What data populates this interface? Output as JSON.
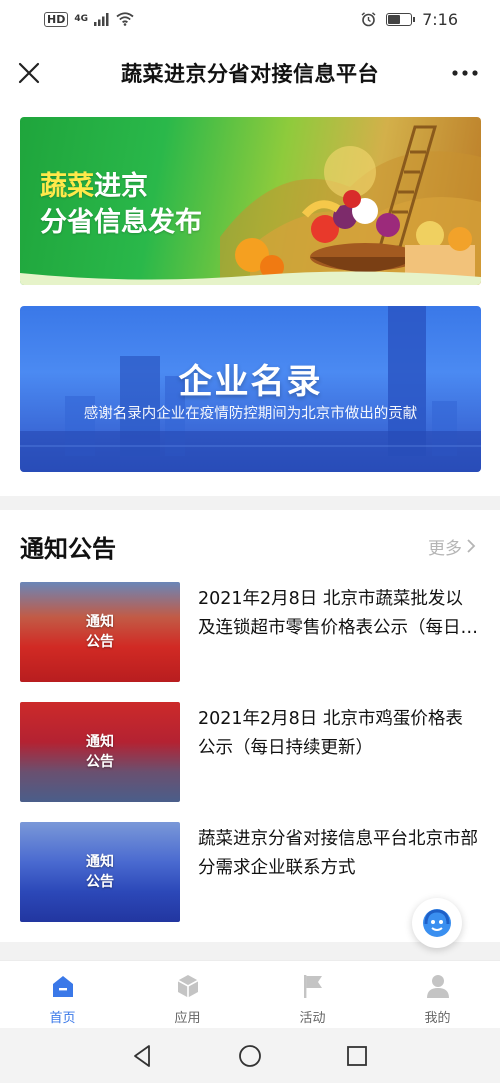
{
  "status_bar": {
    "hd": "HD",
    "network": "4G",
    "time": "7:16"
  },
  "nav": {
    "title": "蔬菜进京分省对接信息平台"
  },
  "banners": {
    "veg": {
      "line1_a": "蔬菜",
      "line1_b": "进京",
      "line2": "分省信息发布"
    },
    "enterprise": {
      "title": "企业名录",
      "subtitle": "感谢名录内企业在疫情防控期间为北京市做出的贡献"
    }
  },
  "notice": {
    "title": "通知公告",
    "more_label": "更多",
    "items": [
      {
        "thumb_text_1": "通知",
        "thumb_text_2": "公告",
        "text": "2021年2月8日 北京市蔬菜批发以及连锁超市零售价格表公示（每日…"
      },
      {
        "thumb_text_1": "通知",
        "thumb_text_2": "公告",
        "text": "2021年2月8日 北京市鸡蛋价格表公示（每日持续更新）"
      },
      {
        "thumb_text_1": "通知",
        "thumb_text_2": "公告",
        "text": "蔬菜进京分省对接信息平台北京市部分需求企业联系方式"
      }
    ]
  },
  "tabs": [
    {
      "label": "首页",
      "icon": "home-icon",
      "active": true
    },
    {
      "label": "应用",
      "icon": "cube-icon",
      "active": false
    },
    {
      "label": "活动",
      "icon": "flag-icon",
      "active": false
    },
    {
      "label": "我的",
      "icon": "user-icon",
      "active": false
    }
  ],
  "colors": {
    "accent": "#3a78e8",
    "inactive_icon": "#c4c4c4"
  }
}
